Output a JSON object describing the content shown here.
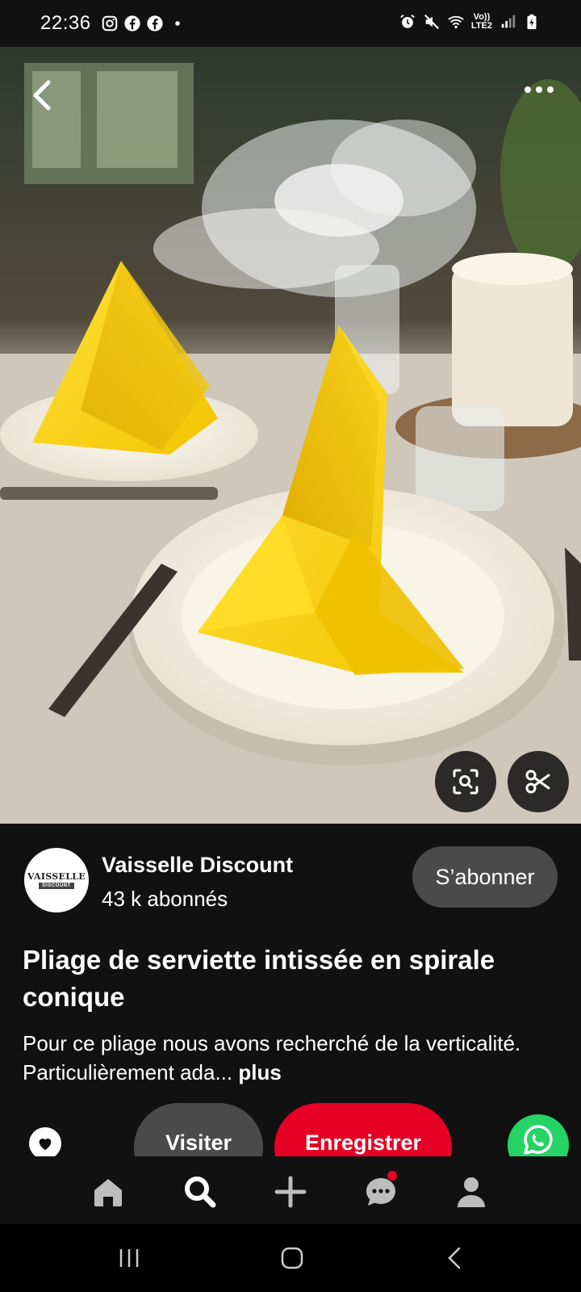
{
  "status_bar": {
    "time": "22:36",
    "left_icons": [
      "instagram-icon",
      "facebook-icon",
      "facebook-icon",
      "dot-icon"
    ],
    "right_icons": [
      "alarm-icon",
      "mute-icon",
      "wifi-icon",
      "volte-icon",
      "signal-icon",
      "battery-charging-icon"
    ],
    "volte_label_top": "Vo))",
    "volte_label_bottom": "LTE2"
  },
  "photo": {
    "alt_subject": "yellow-napkin-fold-photo",
    "back_icon": "chevron-left-icon",
    "more_icon": "more-horizontal-icon",
    "lens_icon": "visual-search-icon",
    "cut_icon": "scissors-icon"
  },
  "profile": {
    "avatar_main": "VAISSELLE",
    "avatar_sub": "DISCOUNT",
    "name": "Vaisselle Discount",
    "followers": "43 k abonnés",
    "subscribe_label": "S’abonner"
  },
  "pin": {
    "title": "Pliage de serviette intissée en spirale conique",
    "description": "Pour ce pliage nous avons recherché de la verticalité. Particulièrement ada...",
    "more_label": "plus"
  },
  "actions": {
    "react_icon": "heart-icon",
    "visit_label": "Visiter",
    "save_label": "Enregistrer",
    "share_icon": "whatsapp-icon"
  },
  "bottom_nav": {
    "items": [
      "home-icon",
      "search-icon",
      "plus-icon",
      "messages-icon",
      "profile-icon"
    ],
    "accent": "#e60023"
  },
  "system_nav": [
    "recents-icon",
    "home-icon",
    "back-icon"
  ]
}
